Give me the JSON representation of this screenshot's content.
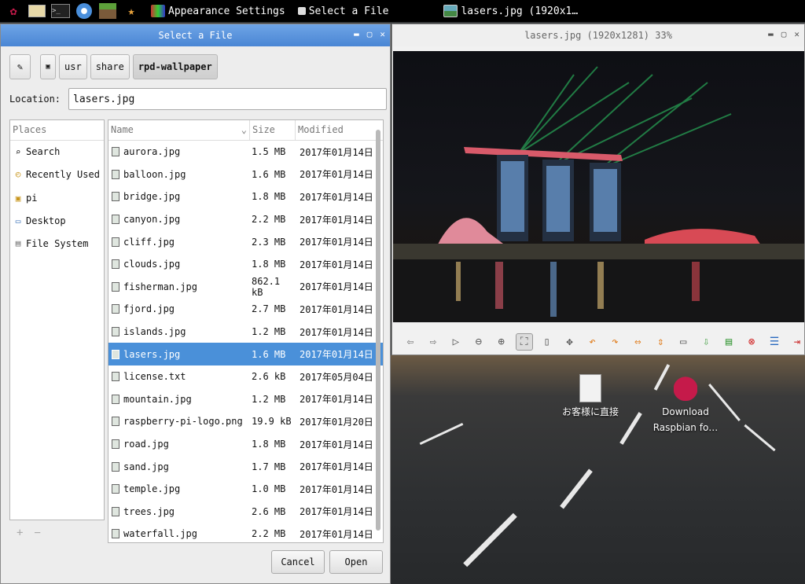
{
  "taskbar": {
    "launchers": [
      {
        "icon": "raspberry-menu-icon"
      },
      {
        "icon": "file-manager-icon"
      },
      {
        "icon": "terminal-icon"
      },
      {
        "icon": "chromium-icon"
      },
      {
        "icon": "minecraft-icon"
      },
      {
        "icon": "mathematica-icon"
      }
    ],
    "tasks": [
      {
        "label": "Appearance Settings",
        "icon": "appearance-settings-icon"
      },
      {
        "label": "Select a File",
        "icon": "dialog-icon"
      },
      {
        "label": "lasers.jpg (1920x1…",
        "icon": "image-viewer-icon"
      }
    ]
  },
  "file_chooser": {
    "title": "Select a File",
    "path_segments": [
      "usr",
      "share",
      "rpd-wallpaper"
    ],
    "location_label": "Location:",
    "location_value": "lasers.jpg",
    "places_header": "Places",
    "places": [
      {
        "label": "Search",
        "icon": "search-icon"
      },
      {
        "label": "Recently Used",
        "icon": "recent-icon"
      },
      {
        "label": "pi",
        "icon": "home-folder-icon"
      },
      {
        "label": "Desktop",
        "icon": "desktop-icon"
      },
      {
        "label": "File System",
        "icon": "drive-icon"
      }
    ],
    "columns": {
      "name": "Name",
      "size": "Size",
      "modified": "Modified"
    },
    "files": [
      {
        "name": "aurora.jpg",
        "size": "1.5 MB",
        "modified": "2017年01月14日"
      },
      {
        "name": "balloon.jpg",
        "size": "1.6 MB",
        "modified": "2017年01月14日"
      },
      {
        "name": "bridge.jpg",
        "size": "1.8 MB",
        "modified": "2017年01月14日"
      },
      {
        "name": "canyon.jpg",
        "size": "2.2 MB",
        "modified": "2017年01月14日"
      },
      {
        "name": "cliff.jpg",
        "size": "2.3 MB",
        "modified": "2017年01月14日"
      },
      {
        "name": "clouds.jpg",
        "size": "1.8 MB",
        "modified": "2017年01月14日"
      },
      {
        "name": "fisherman.jpg",
        "size": "862.1 kB",
        "modified": "2017年01月14日"
      },
      {
        "name": "fjord.jpg",
        "size": "2.7 MB",
        "modified": "2017年01月14日"
      },
      {
        "name": "islands.jpg",
        "size": "1.2 MB",
        "modified": "2017年01月14日"
      },
      {
        "name": "lasers.jpg",
        "size": "1.6 MB",
        "modified": "2017年01月14日",
        "selected": true
      },
      {
        "name": "license.txt",
        "size": "2.6 kB",
        "modified": "2017年05月04日"
      },
      {
        "name": "mountain.jpg",
        "size": "1.2 MB",
        "modified": "2017年01月14日"
      },
      {
        "name": "raspberry-pi-logo.png",
        "size": "19.9 kB",
        "modified": "2017年01月20日"
      },
      {
        "name": "road.jpg",
        "size": "1.8 MB",
        "modified": "2017年01月14日"
      },
      {
        "name": "sand.jpg",
        "size": "1.7 MB",
        "modified": "2017年01月14日"
      },
      {
        "name": "temple.jpg",
        "size": "1.0 MB",
        "modified": "2017年01月14日"
      },
      {
        "name": "trees.jpg",
        "size": "2.6 MB",
        "modified": "2017年01月14日"
      },
      {
        "name": "waterfall.jpg",
        "size": "2.2 MB",
        "modified": "2017年01月14日"
      }
    ],
    "buttons": {
      "cancel": "Cancel",
      "open": "Open"
    }
  },
  "image_viewer": {
    "title": "lasers.jpg (1920x1281) 33%"
  },
  "desktop": {
    "icons": [
      {
        "label": "お客様に直接",
        "icon": "text-file-icon"
      },
      {
        "label": "Download\nRaspbian fo…",
        "icon": "raspberry-pi-icon"
      }
    ]
  },
  "colors": {
    "selection": "#4a90d9",
    "titlebar_active": "#5b95dd"
  }
}
